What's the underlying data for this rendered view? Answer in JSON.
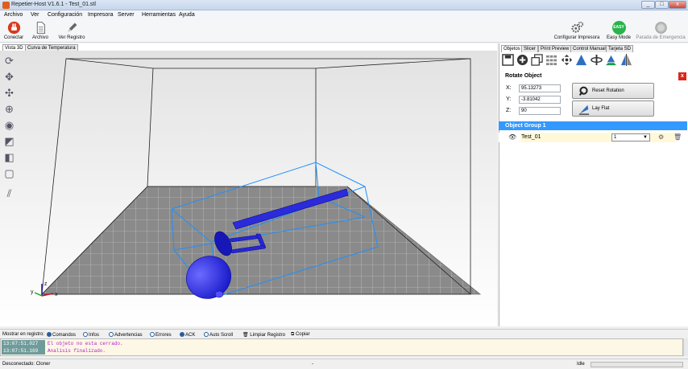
{
  "window": {
    "title": "Repetier-Host V1.6.1 - Test_01.stl",
    "min": "_",
    "max": "□",
    "close": "x"
  },
  "menu": [
    "Archivo",
    "Ver",
    "Configuración",
    "Impresora",
    "Server",
    "Herramientas",
    "Ayuda"
  ],
  "toolbar": {
    "connect": "Conectar",
    "file": "Archivo",
    "log": "Ver Registro",
    "printer_settings": "Configurar Impresora",
    "easy_mode": "Easy Mode",
    "easy_badge": "EASY",
    "emergency": "Parada de Emergencia"
  },
  "left_tabs": [
    "Vista 3D",
    "Curva de Temperatura"
  ],
  "right_tabs": [
    "Objetos",
    "Slicer",
    "Print Preview",
    "Control Manual",
    "Tarjeta SD"
  ],
  "rotate": {
    "title": "Rotate Object",
    "x_label": "X:",
    "x_value": "95.13273",
    "y_label": "Y:",
    "y_value": "-3.81042",
    "z_label": "Z:",
    "z_value": "90",
    "reset_button": "Reset Rotation",
    "layflat_button": "Lay Flat",
    "close_icon": "x"
  },
  "objects": {
    "group": "Object Group 1",
    "item_name": "Test_01",
    "copies": "1"
  },
  "log_options": {
    "label": "Mostrar en registro:",
    "commands": "Comandos",
    "infos": "Infos",
    "warnings": "Advertencias",
    "errors": "Errores",
    "ack": "ACK",
    "autoscroll": "Auto Scroll",
    "clear": "Limpiar Registro",
    "copy": "Copiar"
  },
  "log": [
    {
      "time": "13:07:51.027",
      "text": "El objeto no esta cerrado."
    },
    {
      "time": "13:07:51.169",
      "text": "Analisis finalizado."
    }
  ],
  "status": {
    "connection": "Desconectado: Cloner",
    "middle": "-",
    "state": "Idle"
  }
}
